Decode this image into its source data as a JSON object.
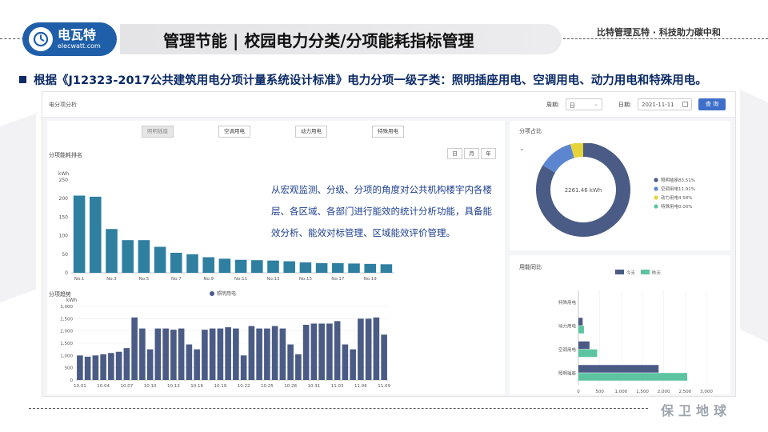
{
  "header": {
    "logo_cn": "电瓦特",
    "logo_en": "elecwatt.com",
    "title": "管理节能 | 校园电力分类/分项能耗指标管理",
    "slogan": "比特管理瓦特 · 科技助力碳中和"
  },
  "subtitle": "根据《J12323-2017公共建筑用电分项计量系统设计标准》电力分项一级子类：照明插座用电、空调用电、动力用电和特殊用电。",
  "topbar": {
    "title": "电分项分析",
    "period_label": "周期:",
    "period_value": "日",
    "date_label": "日期:",
    "date_value": "2021-11-11",
    "query_button": "查 询"
  },
  "category_tabs": [
    "照明插座",
    "空调用电",
    "动力用电",
    "特殊用电"
  ],
  "ranking": {
    "label": "分项能耗排名",
    "period_tabs": [
      "日",
      "月",
      "年"
    ],
    "unit": "kWh"
  },
  "overlay_text": "从宏观监测、分级、分项的角度对公共机构楼宇内各楼层、各区域、各部门进行能效的统计分析功能，具备能效分析、能效对标管理、区域能效评价管理。",
  "trend": {
    "label": "分项趋势",
    "unit": "kWh"
  },
  "proportion": {
    "label": "分项占比",
    "dot": "-"
  },
  "compare": {
    "label": "用能同比"
  },
  "footer": "保卫地球",
  "colors": {
    "bar": "#2e7fa0",
    "trend": "#4a5b85",
    "donut_main": "#4a5b85",
    "donut_blue": "#5c86d0",
    "donut_yellow": "#e6d33a",
    "donut_green": "#5cc4a0",
    "today": "#4a5b85",
    "yesterday": "#5cc4a0"
  },
  "chart_data": [
    {
      "type": "bar",
      "title": "分项能耗排名",
      "ylabel": "kWh",
      "ylim": [
        0,
        250
      ],
      "yticks": [
        0,
        50,
        100,
        150,
        200,
        250
      ],
      "categories": [
        "No.1",
        "No.2",
        "No.3",
        "No.4",
        "No.5",
        "No.6",
        "No.7",
        "No.8",
        "No.9",
        "No.10",
        "No.11",
        "No.12",
        "No.13",
        "No.14",
        "No.15",
        "No.16",
        "No.17",
        "No.18",
        "No.19",
        "No.20"
      ],
      "tick_labels": [
        "No.1",
        "No.3",
        "No.5",
        "No.7",
        "No.9",
        "No.11",
        "No.13",
        "No.15",
        "No.17",
        "No.19"
      ],
      "values": [
        208,
        205,
        118,
        88,
        88,
        70,
        54,
        50,
        42,
        38,
        35,
        34,
        33,
        31,
        28,
        26,
        26,
        25,
        24,
        23
      ]
    },
    {
      "type": "bar",
      "title": "分项趋势",
      "ylabel": "kWh",
      "ylim": [
        0,
        3000
      ],
      "yticks": [
        0,
        500,
        1000,
        1500,
        2000,
        2500,
        3000
      ],
      "x_tick_labels": [
        "10.01",
        "10.04",
        "10.07",
        "10.10",
        "10.13",
        "10.16",
        "10.19",
        "10.22",
        "10.25",
        "10.28",
        "10.31",
        "11.03",
        "11.06",
        "11.09"
      ],
      "series": [
        {
          "name": "照明用电",
          "values": [
            1000,
            950,
            1000,
            1050,
            1100,
            1150,
            1300,
            2550,
            2100,
            1250,
            2100,
            2100,
            2050,
            2100,
            1450,
            1250,
            2050,
            2100,
            2100,
            2150,
            2100,
            1000,
            2200,
            2100,
            2100,
            2200,
            2100,
            1450,
            1050,
            2250,
            2300,
            2300,
            2300,
            2400,
            1450,
            1250,
            2500,
            2500,
            2550,
            1850
          ]
        }
      ]
    },
    {
      "type": "pie",
      "title": "分项占比",
      "center_text": "2261.46 kWh",
      "slices": [
        {
          "name": "照明插座",
          "value": 83.51,
          "label": "照明插座83.51%"
        },
        {
          "name": "空调用电",
          "value": 11.91,
          "label": "空调用电11.91%"
        },
        {
          "name": "动力用电",
          "value": 4.58,
          "label": "动力用电4.58%"
        },
        {
          "name": "特殊用电",
          "value": 0.0,
          "label": "特殊用电0.00%"
        }
      ]
    },
    {
      "type": "bar",
      "orientation": "horizontal",
      "title": "用能同比",
      "categories": [
        "特殊用电",
        "动力用电",
        "空调用电",
        "照明插座"
      ],
      "xlim": [
        0,
        3000
      ],
      "xticks": [
        0,
        500,
        1000,
        1500,
        2000,
        2500,
        3000
      ],
      "series": [
        {
          "name": "今天",
          "values": [
            0,
            100,
            260,
            1880
          ]
        },
        {
          "name": "昨天",
          "values": [
            0,
            130,
            440,
            2550
          ]
        }
      ]
    }
  ]
}
